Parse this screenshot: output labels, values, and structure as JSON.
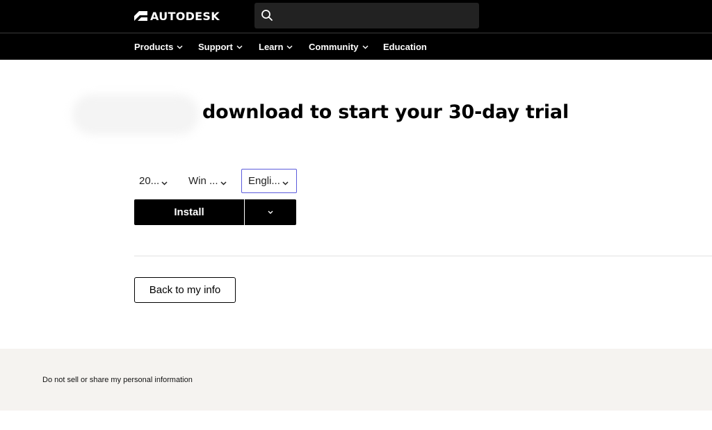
{
  "header": {
    "brand": "AUTODESK",
    "search": {
      "placeholder": "",
      "value": ""
    }
  },
  "nav": {
    "items": [
      {
        "label": "Products",
        "has_dropdown": true
      },
      {
        "label": "Support",
        "has_dropdown": true
      },
      {
        "label": "Learn",
        "has_dropdown": true
      },
      {
        "label": "Community",
        "has_dropdown": true
      },
      {
        "label": "Education",
        "has_dropdown": false
      }
    ]
  },
  "main": {
    "headline": "download to start your 30-day trial",
    "selectors": {
      "version": "20...",
      "os": "Win ...",
      "language": "Engli..."
    },
    "install_label": "Install",
    "back_label": "Back to my info"
  },
  "footer": {
    "privacy_link": "Do not sell or share my personal information"
  },
  "colors": {
    "header_bg": "#000000",
    "footer_bg": "#f5f3f0",
    "focus_outline": "#5b5bdc"
  }
}
